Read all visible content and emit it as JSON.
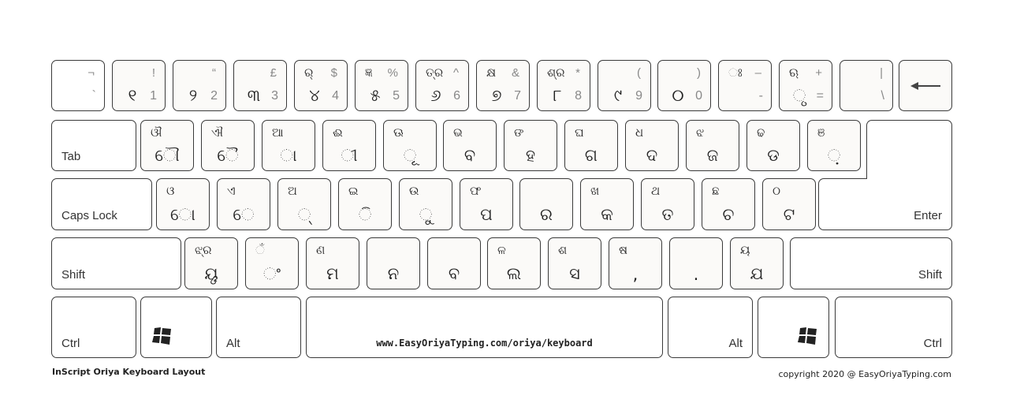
{
  "rows": [
    [
      {
        "top": "",
        "sym": "¬",
        "main": "",
        "num": "`"
      },
      {
        "top": "",
        "sym": "!",
        "main": "୧",
        "num": "1"
      },
      {
        "top": "",
        "sym": "“",
        "main": "୨",
        "num": "2"
      },
      {
        "top": "",
        "sym": "£",
        "main": "୩",
        "num": "3"
      },
      {
        "top": "ର୍",
        "sym": "$",
        "main": "୪",
        "num": "4"
      },
      {
        "top": "ଜ୍ଞ",
        "sym": "%",
        "main": "୫",
        "num": "5"
      },
      {
        "top": "ତ୍ର",
        "sym": "^",
        "main": "୬",
        "num": "6"
      },
      {
        "top": "କ୍ଷ",
        "sym": "&",
        "main": "୭",
        "num": "7"
      },
      {
        "top": "ଶ୍ର",
        "sym": "*",
        "main": "୮",
        "num": "8"
      },
      {
        "top": "",
        "sym": "(",
        "main": "୯",
        "num": "9"
      },
      {
        "top": "",
        "sym": ")",
        "main": "୦",
        "num": "0"
      },
      {
        "top": "ଃ",
        "sym": "–",
        "main": "",
        "num": "-"
      },
      {
        "top": "ଋ",
        "sym": "+",
        "main": "ୃ",
        "num": "="
      },
      {
        "top": "",
        "sym": "|",
        "main": "",
        "num": "\\"
      }
    ],
    [
      {
        "top": "ଔ",
        "main": "ୌ"
      },
      {
        "top": "ଐ",
        "main": "ୈ"
      },
      {
        "top": "ଆ",
        "main": "ା"
      },
      {
        "top": "ଈ",
        "main": "ୀ"
      },
      {
        "top": "ଊ",
        "main": "ୂ"
      },
      {
        "top": "ଭ",
        "main": "ବ"
      },
      {
        "top": "ଙ",
        "main": "ହ"
      },
      {
        "top": "ଘ",
        "main": "ଗ"
      },
      {
        "top": "ଧ",
        "main": "ଦ"
      },
      {
        "top": "ଝ",
        "main": "ଜ"
      },
      {
        "top": "ଢ",
        "main": "ଡ"
      },
      {
        "top": "ଞ",
        "main": "଼"
      }
    ],
    [
      {
        "top": "ଓ",
        "main": "ୋ"
      },
      {
        "top": "ଏ",
        "main": "େ"
      },
      {
        "top": "ଅ",
        "main": "୍"
      },
      {
        "top": "ଇ",
        "main": "ି"
      },
      {
        "top": "ଉ",
        "main": "ୁ"
      },
      {
        "top": "ଫ",
        "main": "ପ"
      },
      {
        "top": "",
        "main": "ର"
      },
      {
        "top": "ଖ",
        "main": "କ"
      },
      {
        "top": "ଥ",
        "main": "ତ"
      },
      {
        "top": "ଛ",
        "main": "ଚ"
      },
      {
        "top": "ଠ",
        "main": "ଟ"
      }
    ],
    [
      {
        "top": "ଝ୍ର",
        "main": "ୟୃ"
      },
      {
        "top": "ଁ",
        "main": "ଂ"
      },
      {
        "top": "ଣ",
        "main": "ମ"
      },
      {
        "top": "",
        "main": "ନ"
      },
      {
        "top": "",
        "main": "ବ"
      },
      {
        "top": "ଳ",
        "main": "ଲ"
      },
      {
        "top": "ଶ",
        "main": "ସ"
      },
      {
        "top": "ଷ",
        "main": ","
      },
      {
        "top": "",
        "main": "."
      },
      {
        "top": "ୟ",
        "main": "ଯ"
      }
    ]
  ],
  "modifiers": {
    "tab": "Tab",
    "caps": "Caps Lock",
    "enter": "Enter",
    "shift_left": "Shift",
    "shift_right": "Shift",
    "ctrl_left": "Ctrl",
    "alt_left": "Alt",
    "alt_right": "Alt",
    "ctrl_right": "Ctrl",
    "backspace_icon": "left-arrow-icon",
    "win_icon": "windows-logo-icon"
  },
  "space_text": "www.EasyOriyaTyping.com/oriya/keyboard",
  "footer": {
    "title": "InScript Oriya Keyboard Layout",
    "copyright": "copyright 2020 @ EasyOriyaTyping.com"
  }
}
